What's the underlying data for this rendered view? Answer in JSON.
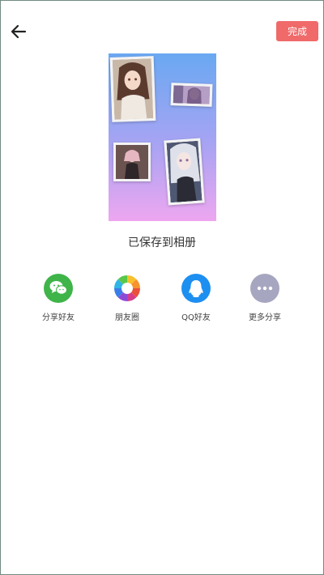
{
  "header": {
    "done_label": "完成"
  },
  "status": {
    "saved_text": "已保存到相册"
  },
  "share": {
    "items": [
      {
        "label": "分享好友",
        "icon": "wechat-icon",
        "color": "#3fb449"
      },
      {
        "label": "朋友圈",
        "icon": "moments-icon",
        "color": "#ffffff"
      },
      {
        "label": "QQ好友",
        "icon": "qq-icon",
        "color": "#1d8ff0"
      },
      {
        "label": "更多分享",
        "icon": "more-icon",
        "color": "#a6a6c0"
      }
    ]
  },
  "colors": {
    "accent": "#f06a6a",
    "preview_gradient_top": "#6aa8f2",
    "preview_gradient_bottom": "#eea6f0"
  }
}
